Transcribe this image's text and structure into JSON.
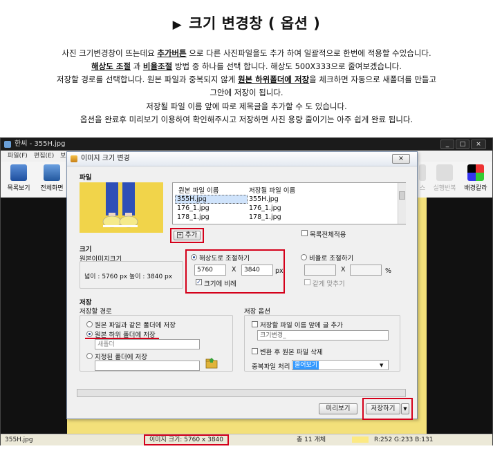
{
  "heading": {
    "marker": "▶",
    "text": "크기 변경창 ( 옵션 )"
  },
  "description": {
    "line1_a": "사진 크기변경창이 뜨는데요 ",
    "line1_b": "추가버튼",
    "line1_c": " 으로 다른  사진파일을도 추가 하여 일괄적으로 한번에  적용할 수있습니다.",
    "line2_a": "해상도 조절",
    "line2_b": " 과 ",
    "line2_c": "비율조절",
    "line2_d": " 방법 중 하나를 선택 합니다. 해상도 500X333으로 줄여보겠습니다.",
    "line3_a": "저장할 경로를  선택합니다.  원본 파일과 중복되지 않게 ",
    "line3_b": "원본 하위폴더에 저장",
    "line3_c": "을 체크하면 자동으로 새폴더를 만들고",
    "line4": "그안에 저장이 됩니다.",
    "line5": "저장될 파일 이름 앞에 따로 제목글을 추가할 수 도 있습니다.",
    "line6": "옵션을 완료후 미리보기 이용하여 확인해주시고 저장하면 사진 용량 줄이기는 아주 쉽게 완료  됩니다."
  },
  "app": {
    "title": "한씨 - 355H.jpg",
    "menu": [
      "파일(F)",
      "편집(E)",
      "보"
    ],
    "toolbar_left": [
      "목록보기",
      "전체화면"
    ],
    "toolbar_right": [
      "실행반복",
      "배경칼라"
    ],
    "toolbar_right_partial": "스",
    "window_controls": [
      "_",
      "□",
      "×"
    ],
    "status": {
      "filename": "355H.jpg",
      "size": "이미지 크기: 5760 x 3840",
      "count": "총 11 개체",
      "rgb": "R:252 G:233 B:131"
    }
  },
  "dialog": {
    "title": "이미지 크기 변경",
    "close": "×",
    "file_section": "파일",
    "columns": [
      "원본 파일 이름",
      "저장될 파일 이름"
    ],
    "files": [
      {
        "orig": "355H.jpg",
        "saved": "355H.jpg",
        "selected": true
      },
      {
        "orig": "176_1.jpg",
        "saved": "176_1.jpg",
        "selected": false
      },
      {
        "orig": "178_1.jpg",
        "saved": "178_1.jpg",
        "selected": false
      },
      {
        "orig": "178_1.jpg",
        "saved": "178_1.jpg",
        "selected": false
      }
    ],
    "add_button": "추가",
    "add_symbol": "+",
    "apply_all": "목록전체적용",
    "size_section": "크기",
    "original_size_label": "원본이미지크기",
    "original_size_value": "넓이 :   5760  px  높이 : 3840  px",
    "resolution_option": "해상도로 조절하기",
    "width_value": "5760",
    "height_value": "3840",
    "times": "X",
    "px": "px",
    "keep_ratio": "크기에 비례",
    "ratio_option": "비율로 조절하기",
    "percent": "%",
    "same_fit": "같게 맞추기",
    "save_section": "저장",
    "save_path_label": "저장할 경로",
    "path_option1": "원본 파일과 같은 폴더에 저장",
    "path_option2": "원본 하위 폴더에 저장",
    "subfolder_name": "새폴더",
    "path_option3": "지정된 폴더에 저장",
    "save_options_label": "저장 옵션",
    "prefix_option": "저장할 파일 이름 앞에 글 추가",
    "prefix_value": "크기변경_",
    "delete_original": "변환 후 원본 파일 삭제",
    "duplicate_label": "중복파일 처리",
    "duplicate_value": "물어보기",
    "preview_button": "미리보기",
    "save_button": "저장하기",
    "save_arrow": "▼"
  },
  "colors": {
    "highlight_red": "#d4001a",
    "selection_blue": "#3399ff",
    "yellow_bg": "#f3e07a"
  }
}
